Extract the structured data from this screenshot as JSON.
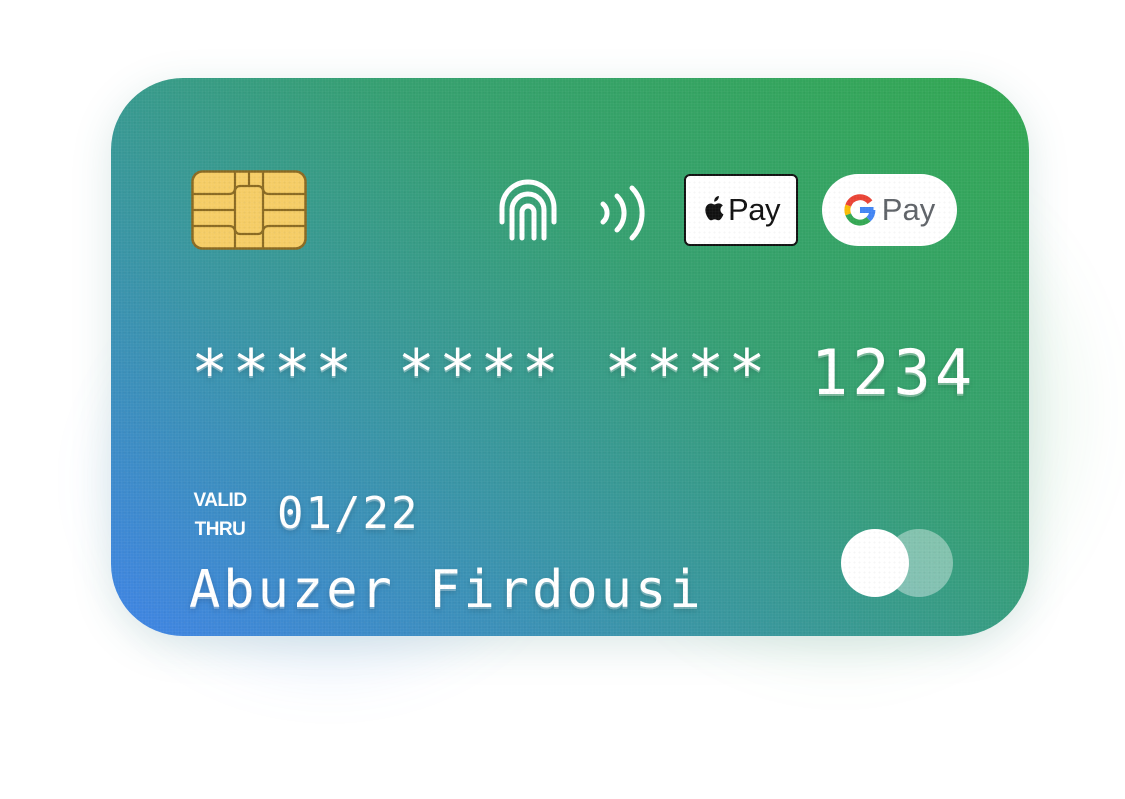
{
  "card": {
    "number": "**** **** **** 1234",
    "valid_label_line1": "VALID",
    "valid_label_line2": "THRU",
    "expiry": "01/22",
    "holder_name": "Abuzer Firdousi"
  },
  "payment_badges": {
    "apple_pay_label": "Pay",
    "google_pay_label": "Pay"
  },
  "icons": {
    "chip": "emv-chip-icon",
    "lock": "nfc-lock-icon",
    "contactless": "contactless-icon",
    "apple": "apple-logo-icon",
    "google": "google-g-icon",
    "network": "card-network-logo"
  },
  "colors": {
    "gradient_blue": "#4084e6",
    "gradient_teal": "#3a96a4",
    "gradient_green": "#33a852",
    "chip_fill": "#f5cd66",
    "chip_stroke": "#8a6a22",
    "text": "#ffffff"
  }
}
